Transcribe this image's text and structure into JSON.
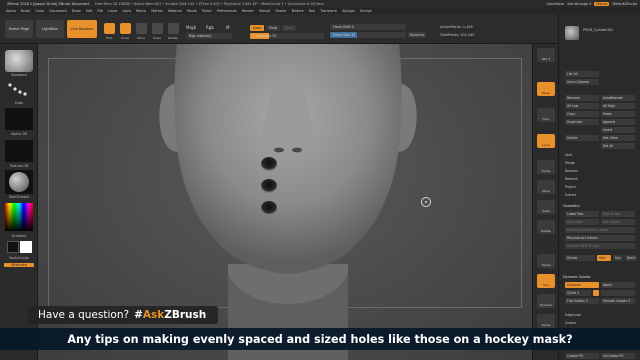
{
  "titlebar": {
    "document": "ZBrush 2018.1 [Joseph Drust]   ZBrush Document",
    "status": [
      "Free Mem 26.138GB",
      "Active Mem 657",
      "Scratch Disk 104",
      "ZTime 5.003",
      "PolyCount 1.641 KP",
      "MeshCount 1"
    ],
    "quicksave": "QuickSave in 59 Secs",
    "quicksave_btn": "QuickSave",
    "seethrough": "See-through 0",
    "menus_btn": "Menus",
    "default_script": "DefaultZScript"
  },
  "menubar": [
    "Alpha",
    "Brush",
    "Color",
    "Document",
    "Draw",
    "Edit",
    "File",
    "Layer",
    "Light",
    "Macro",
    "Marker",
    "Material",
    "Movie",
    "Picker",
    "Preferences",
    "Render",
    "Stencil",
    "Stroke",
    "Texture",
    "Tool",
    "Transform",
    "Zplugin",
    "Zscript"
  ],
  "toolbar": {
    "home": "Home Page",
    "lightbox": "LightBox",
    "live_boolean": "Live Boolean",
    "edit": "Edit",
    "draw": "Draw",
    "move": "Move",
    "scale": "Scale",
    "rotate": "Rotate",
    "mrgb": "Mrgb",
    "rgb": "Rgb",
    "m": "M",
    "zadd": "Zadd",
    "zsub": "Zsub",
    "zcut": "Zcut",
    "rgb_intensity": "Rgb Intensity",
    "z_intensity": "Z Intensity 25",
    "focal_shift": "Focal Shift 0",
    "draw_size": "Draw Size 33",
    "dynamic": "Dynamic",
    "active_points": "ActivePoints: 1,446",
    "total_points": "TotalPoints: 102,445"
  },
  "leftpanel": {
    "brush_label": "Standard",
    "stroke_label": "Dots",
    "alpha_label": "Alpha Off",
    "texture_label": "Texture Off",
    "material_label": "SkinShade4",
    "gradient_label": "Gradient",
    "switch_label": "SwitchColor",
    "alternate_label": "Alternate"
  },
  "shelf": [
    "SPix 3",
    "Persp",
    "Floor",
    "Local",
    "Frame",
    "Move",
    "Scale",
    "Rotate",
    "Transp",
    "Solo",
    "Dynamic",
    "Xpose"
  ],
  "tray": {
    "tool_name": "PM3D_Cylinder3D1",
    "list_all": "List All",
    "auto_collapse": "Auto Collapse",
    "subtool_actions": [
      "Rename",
      "AutoReorder",
      "All Low",
      "All High",
      "Copy",
      "Paste",
      "Duplicate",
      "Append",
      "Insert",
      "Delete",
      "Del Other",
      "Del All",
      "Split",
      "Merge",
      "Boolean",
      "Remesh",
      "Project",
      "Extract"
    ],
    "geometry": "Geometry",
    "lower_res": "Lower Res",
    "higher_res": "Higher Res",
    "del_lower": "Del Lower",
    "del_higher": "Del Higher",
    "freeze_subdiv": "Freeze SubDivision Levels",
    "reconstruct": "Reconstruct Subdiv",
    "convert_bpr": "Convert BPR To Geo",
    "divide": "Divide",
    "smt": "Smt",
    "suv": "Suv",
    "reuv": "ReUV",
    "dynamic_subdiv": "Dynamic Subdiv",
    "dynamic_btn": "Dynamic",
    "apply": "Apply",
    "qgrid": "QGrid 2",
    "flat_subdiv": "Flat Subdiv 0",
    "smooth_subdiv": "Smooth Subdiv 0",
    "edgeloop": "EdgeLoop",
    "crease": "Crease",
    "crease_pg": "Crease PG",
    "uncrease_pg": "UnCrease PG"
  },
  "banner": {
    "question": "Have a question?",
    "hashtag_prefix": "#",
    "hashtag_ask": "Ask",
    "hashtag_suffix": "ZBrush"
  },
  "caption": "Any tips on making evenly spaced and sized holes like those on a hockey mask?",
  "colors": {
    "accent": "#e8912b",
    "caption_bg": "#06182a",
    "panel": "#2a2a2a"
  }
}
